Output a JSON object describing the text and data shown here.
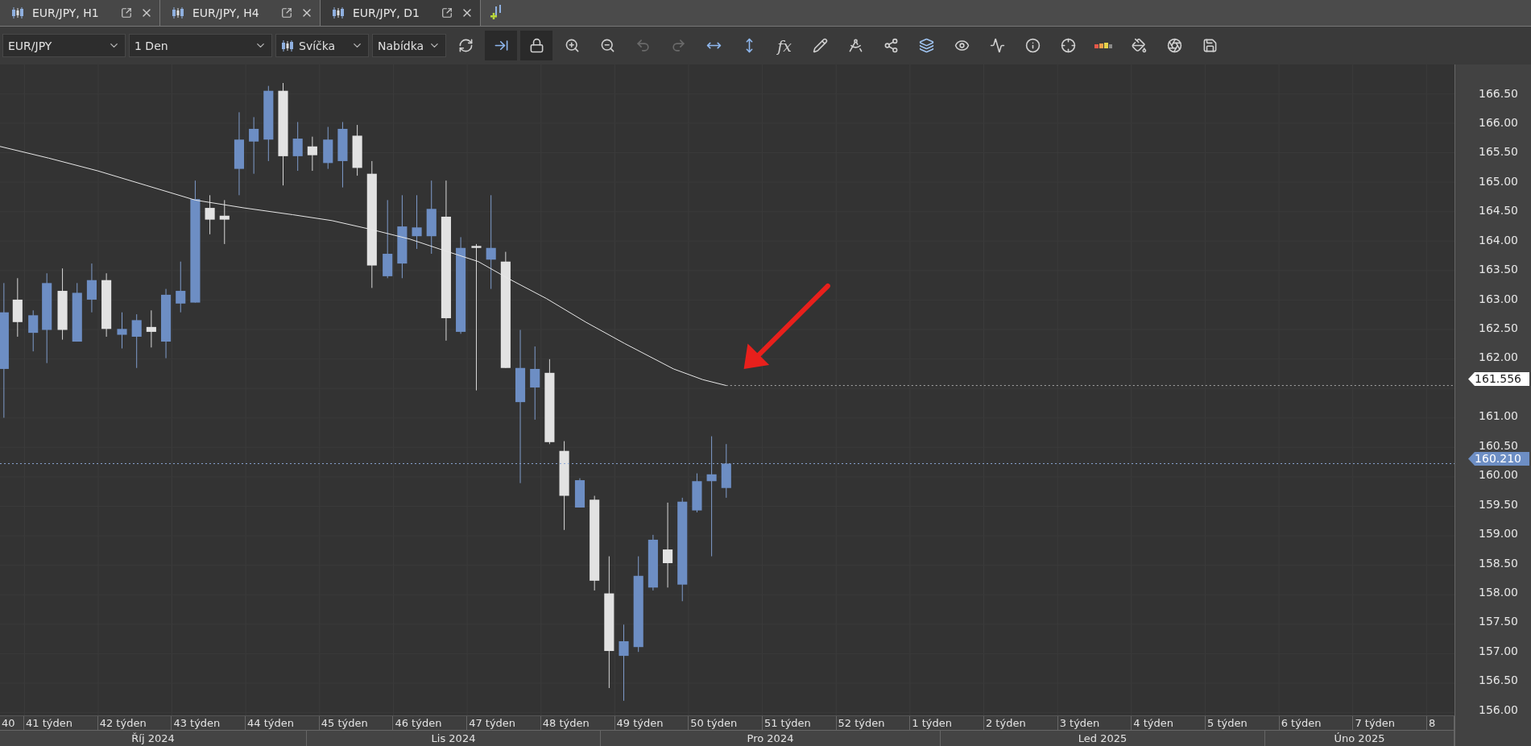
{
  "tabs": [
    {
      "label": "EUR/JPY, H1",
      "selected": false
    },
    {
      "label": "EUR/JPY, H4",
      "selected": false
    },
    {
      "label": "EUR/JPY, D1",
      "selected": true
    }
  ],
  "toolbar": {
    "selects": [
      {
        "value": "EUR/JPY",
        "kind": "plain"
      },
      {
        "value": "1 Den",
        "kind": "plain"
      },
      {
        "value": "Svíčka",
        "kind": "candle"
      },
      {
        "value": "Nabídka",
        "kind": "plain"
      }
    ],
    "tools": [
      {
        "kind": "refresh",
        "active": false,
        "disabled": false
      },
      {
        "kind": "shift",
        "active": true,
        "disabled": false
      },
      {
        "kind": "lock",
        "active": true,
        "disabled": false
      },
      {
        "kind": "zoom-in",
        "active": false,
        "disabled": false
      },
      {
        "kind": "zoom-out",
        "active": false,
        "disabled": false
      },
      {
        "kind": "undo",
        "active": false,
        "disabled": true
      },
      {
        "kind": "redo",
        "active": false,
        "disabled": true
      },
      {
        "kind": "horizontal",
        "active": false,
        "disabled": false
      },
      {
        "kind": "vertical",
        "active": false,
        "disabled": false
      },
      {
        "kind": "formula",
        "label": "fx",
        "active": false,
        "disabled": false
      },
      {
        "kind": "pencil",
        "active": false,
        "disabled": false
      },
      {
        "kind": "compass",
        "active": false,
        "disabled": false
      },
      {
        "kind": "network",
        "active": false,
        "disabled": false
      },
      {
        "kind": "layers",
        "active": false,
        "disabled": false
      },
      {
        "kind": "eye",
        "active": false,
        "disabled": false
      },
      {
        "kind": "alert",
        "active": false,
        "disabled": false
      },
      {
        "kind": "info",
        "active": false,
        "disabled": false
      },
      {
        "kind": "crosshair",
        "active": false,
        "disabled": false
      },
      {
        "kind": "bars",
        "active": false,
        "disabled": false
      },
      {
        "kind": "bucket",
        "active": false,
        "disabled": false
      },
      {
        "kind": "aperture",
        "active": false,
        "disabled": false
      },
      {
        "kind": "save",
        "active": false,
        "disabled": false
      }
    ]
  },
  "chart": {
    "price_labels": [
      "166.50",
      "166.00",
      "165.50",
      "165.00",
      "164.50",
      "164.00",
      "163.50",
      "163.00",
      "162.50",
      "162.00",
      "161.00",
      "160.50",
      "160.00",
      "159.50",
      "159.00",
      "158.50",
      "158.00",
      "157.50",
      "157.00",
      "156.50",
      "156.00"
    ],
    "markers": [
      {
        "text": "161.556",
        "kind": "average"
      },
      {
        "text": "160.210",
        "kind": "price"
      }
    ],
    "week_labels": [
      "40",
      "41 týden",
      "42 týden",
      "43 týden",
      "44 týden",
      "45 týden",
      "46 týden",
      "47 týden",
      "48 týden",
      "49 týden",
      "50 týden",
      "51 týden",
      "52 týden",
      "1 týden",
      "2 týden",
      "3 týden",
      "4 týden",
      "5 týden",
      "6 týden",
      "7 týden",
      "8"
    ],
    "month_labels": [
      "Říj 2024",
      "Lis 2024",
      "Pro 2024",
      "Led 2025",
      "Úno 2025"
    ]
  }
}
